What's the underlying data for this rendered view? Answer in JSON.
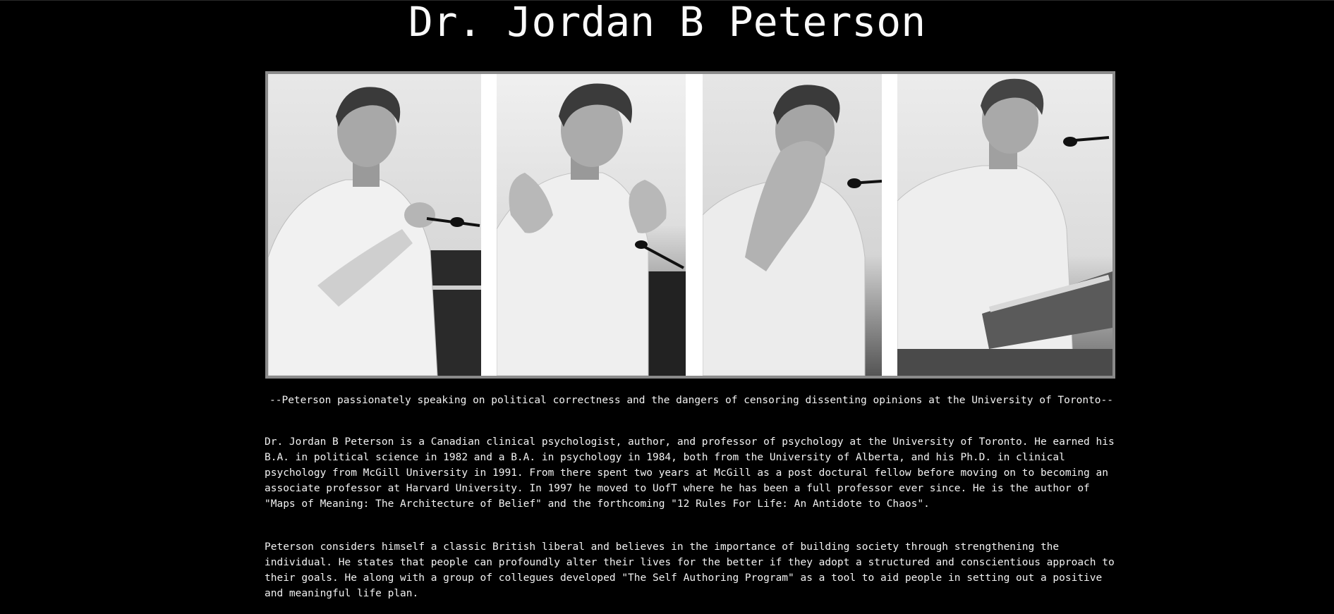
{
  "page": {
    "title": "Dr. Jordan B Peterson"
  },
  "photo": {
    "panels": [
      {
        "icon": "portrait-photo-1"
      },
      {
        "icon": "portrait-photo-2"
      },
      {
        "icon": "portrait-photo-3"
      },
      {
        "icon": "portrait-photo-4"
      }
    ],
    "colors": {
      "frame": "#8a8a8a",
      "background": "#000000"
    }
  },
  "caption": "--Peterson passionately speaking on political correctness and the dangers of censoring dissenting opinions at the University of Toronto--",
  "bio": {
    "paragraph1": "Dr. Jordan B Peterson is a Canadian clinical psychologist, author, and professor of psychology at the University of Toronto. He earned his B.A. in political science in 1982 and a B.A. in psychology in 1984, both from the University of Alberta, and his Ph.D. in clinical psychology from McGill University in 1991. From there spent two years at McGill as a post doctural fellow before moving on to becoming an associate professor at Harvard University. In 1997 he moved to UofT where he has been a full professor ever since. He is the author of \"Maps of Meaning: The Architecture of Belief\" and the forthcoming \"12 Rules For Life: An Antidote to Chaos\".",
    "paragraph2": "Peterson considers himself a classic British liberal and believes in the importance of building society through strengthening the individual. He states that people can profoundly alter their lives for the better if they adopt a structured and conscientious approach to their goals. He along with a group of collegues developed \"The Self Authoring Program\" as a tool to aid people in setting out a positive and meaningful life plan."
  }
}
